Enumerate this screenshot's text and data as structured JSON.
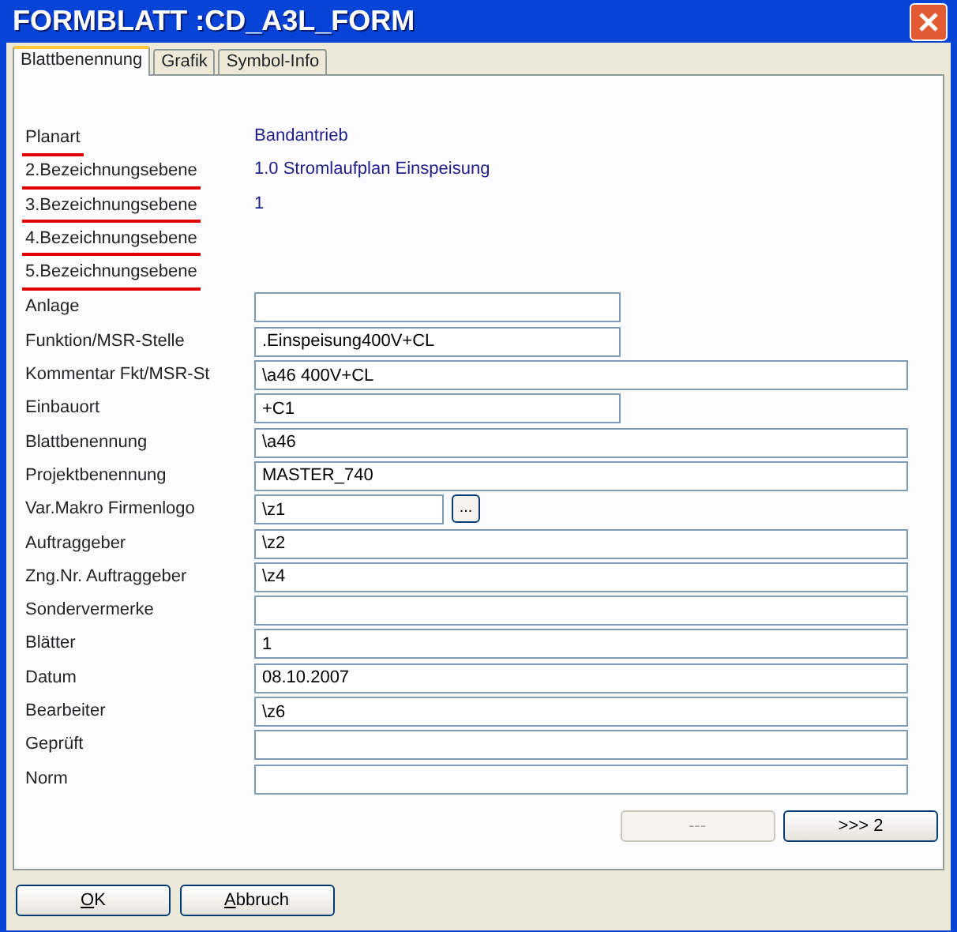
{
  "window": {
    "title": "FORMBLATT :CD_A3L_FORM"
  },
  "tabs": [
    {
      "label": "Blattbenennung",
      "selected": true
    },
    {
      "label": "Grafik",
      "selected": false
    },
    {
      "label": "Symbol-Info",
      "selected": false
    }
  ],
  "header_rows": [
    {
      "label": "Planart",
      "value": "Bandantrieb",
      "underlined": true
    },
    {
      "label": "2.Bezeichnungsebene",
      "value": "1.0 Stromlaufplan Einspeisung",
      "underlined": true
    },
    {
      "label": "3.Bezeichnungsebene",
      "value": "1",
      "underlined": true
    },
    {
      "label": "4.Bezeichnungsebene",
      "underlined": true
    },
    {
      "label": "5.Bezeichnungsebene",
      "underlined": true
    }
  ],
  "fields": [
    {
      "label": "Anlage",
      "kind": "narrow"
    },
    {
      "label": "Funktion/MSR-Stelle",
      "value": ".Einspeisung400V+CL",
      "kind": "narrow"
    },
    {
      "label": "Kommentar Fkt/MSR-St",
      "value": "\\a46 400V+CL",
      "kind": "wide"
    },
    {
      "label": "Einbauort",
      "value": "+C1",
      "kind": "narrow"
    },
    {
      "label": "Blattbenennung",
      "value": "\\a46",
      "kind": "wide"
    },
    {
      "label": "Projektbenennung",
      "value": "MASTER_740",
      "kind": "wide"
    },
    {
      "label": "Var.Makro Firmenlogo",
      "value": "\\z1",
      "kind": "browse",
      "browse_label": "..."
    },
    {
      "label": "Auftraggeber",
      "value": "\\z2",
      "kind": "wide"
    },
    {
      "label": "Zng.Nr. Auftraggeber",
      "value": "\\z4",
      "kind": "wide"
    },
    {
      "label": "Sondervermerke",
      "kind": "wide"
    },
    {
      "label": "Blätter",
      "value": "1",
      "kind": "wide"
    },
    {
      "label": "Datum",
      "value": "08.10.2007",
      "kind": "wide"
    },
    {
      "label": "Bearbeiter",
      "value": "\\z6",
      "kind": "wide"
    },
    {
      "label": "Geprüft",
      "kind": "wide"
    },
    {
      "label": "Norm",
      "kind": "wide"
    }
  ],
  "page_buttons": [
    {
      "label": "---",
      "disabled": true
    },
    {
      "label": ">>> 2",
      "disabled": false
    }
  ],
  "dialog_buttons": [
    {
      "label": "OK",
      "access_key_underlined": true
    },
    {
      "label": "Abbruch",
      "access_key_underlined": true
    }
  ]
}
